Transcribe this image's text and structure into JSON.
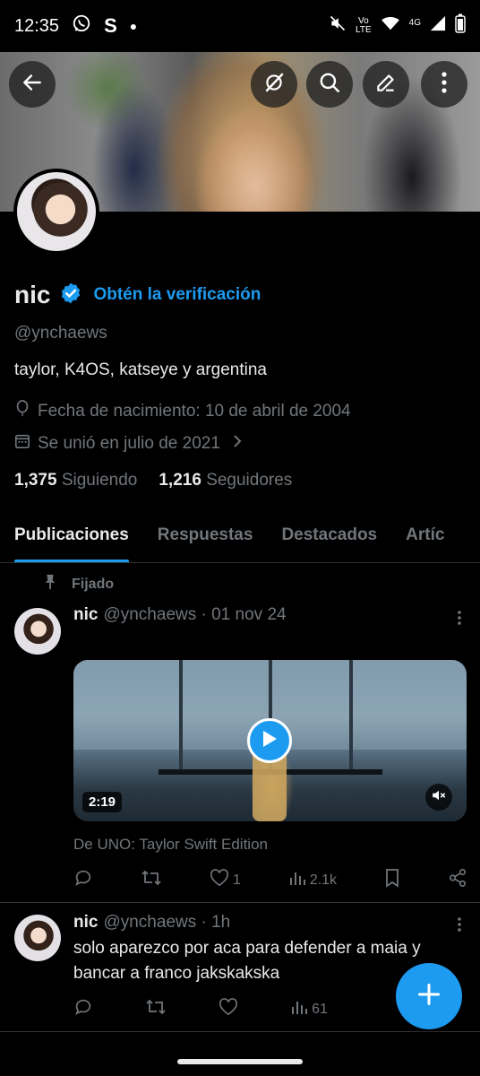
{
  "status_bar": {
    "time": "12:35",
    "left_icons": [
      "whatsapp-icon",
      "s-app-icon",
      "dot-icon"
    ],
    "s_glyph": "S",
    "volte_top": "Vo",
    "volte_bottom": "LTE",
    "network": "4G",
    "right_icons": [
      "mute-icon",
      "volte-icon",
      "wifi-icon",
      "signal-icon",
      "battery-icon"
    ]
  },
  "header_buttons": [
    "back-arrow-icon",
    "grok-icon",
    "search-icon",
    "edit-icon",
    "more-vertical-icon"
  ],
  "profile": {
    "name": "nic",
    "verify_cta": "Obtén la verificación",
    "handle": "@ynchaews",
    "bio": "taylor, K4OS, katseye y argentina",
    "birth": "Fecha de nacimiento: 10 de abril de 2004",
    "joined": "Se unió en julio de 2021",
    "following_count": "1,375",
    "following_label": "Siguiendo",
    "followers_count": "1,216",
    "followers_label": "Seguidores"
  },
  "tabs": [
    "Publicaciones",
    "Respuestas",
    "Destacados",
    "Artíc"
  ],
  "pinned_label": "Fijado",
  "posts": [
    {
      "name": "nic",
      "meta": "@ynchaews · 01 nov 24",
      "duration": "2:19",
      "source": "De UNO: Taylor Swift Edition",
      "likes": "1",
      "views": "2.1k"
    },
    {
      "name": "nic",
      "meta": "@ynchaews · 1h",
      "text": "solo aparezco por aca para defender a maia y bancar a franco jakskakska",
      "views": "61"
    }
  ],
  "colors": {
    "accent": "#1d9bf0",
    "background": "#000000",
    "text_primary": "#e7e9ea",
    "text_secondary": "#71767b",
    "divider": "#2f3336"
  }
}
